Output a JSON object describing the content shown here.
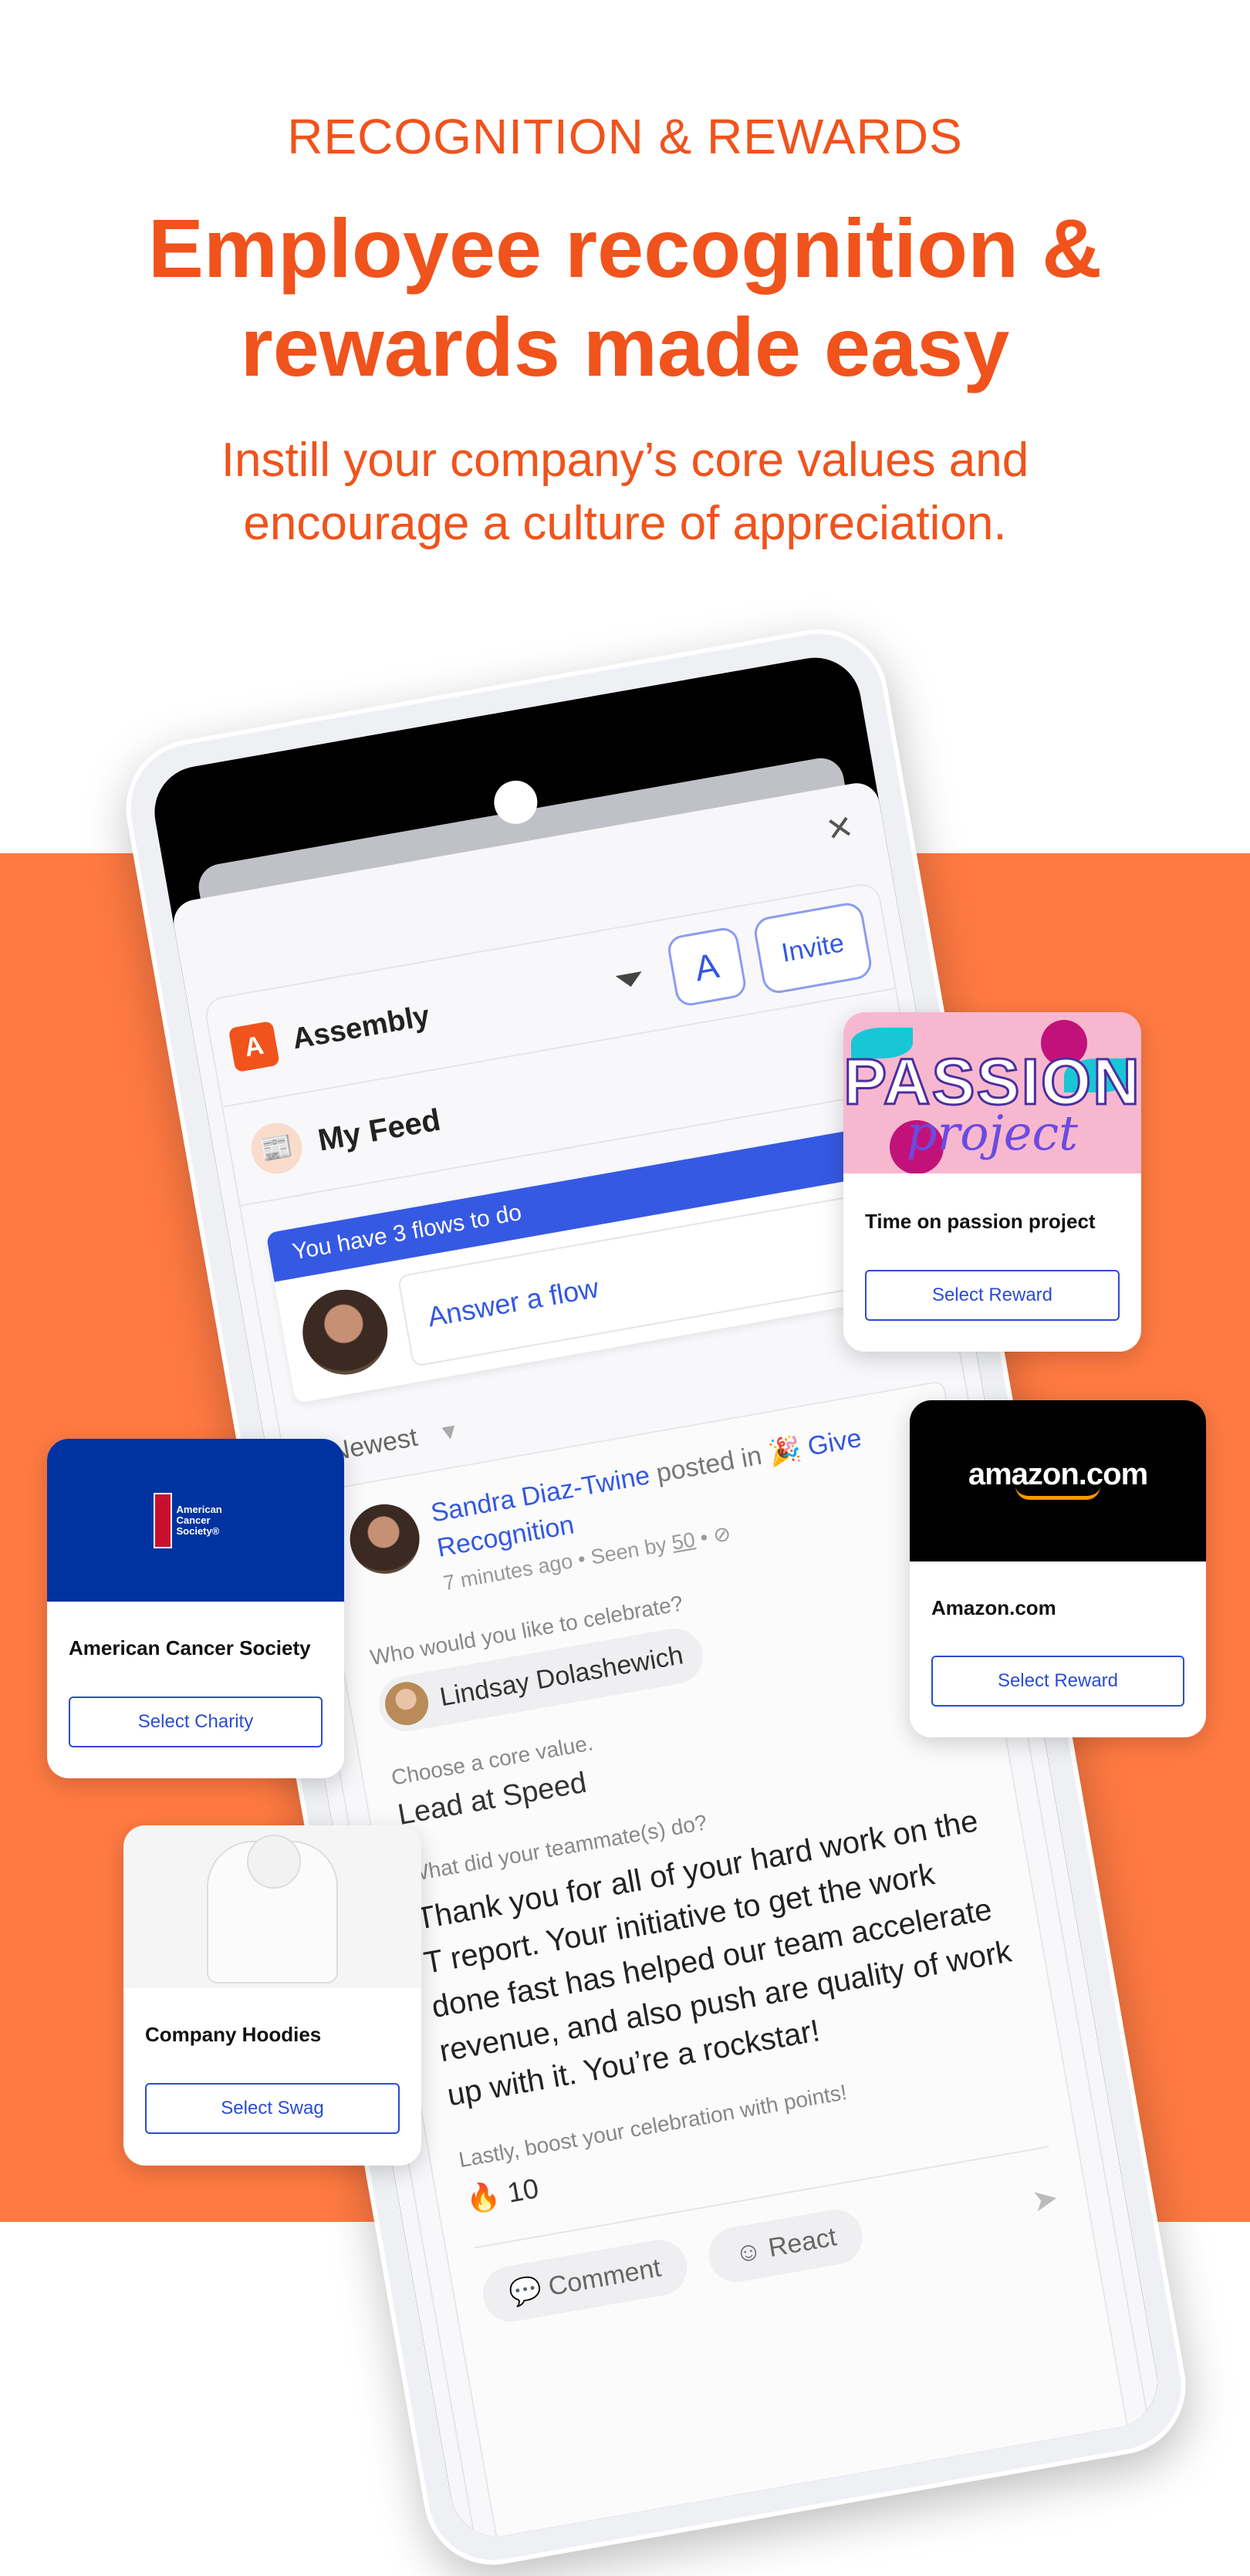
{
  "hero": {
    "eyebrow": "RECOGNITION & REWARDS",
    "title_line1": "Employee recognition &",
    "title_line2": "rewards made easy",
    "subtitle_line1": "Instill your company’s core values and",
    "subtitle_line2": "encourage a culture of appreciation."
  },
  "colors": {
    "brand_orange": "#F0531C",
    "band_orange": "#FF7A42",
    "accent_blue": "#3659E3",
    "button_blue": "#2B4BD6"
  },
  "app": {
    "close_icon": "×",
    "brand": "Assembly",
    "logo_glyph": "A",
    "invite_label": "Invite",
    "cube_glyph": "A",
    "feed_title": "My Feed",
    "banner": "You have 3 flows to do",
    "answer_placeholder": "Answer a flow",
    "sort_label": "Newest",
    "sort_caret": "▾",
    "post": {
      "author": "Sandra Diaz-Twine",
      "posted_in": " posted in ",
      "flow_emoji": "🎉",
      "flow": " Give Recognition",
      "time": "7 minutes ago",
      "seen_prefix": " • Seen by ",
      "seen_count": "50",
      "seen_suffix": " • ",
      "q1": "Who would you like to celebrate?",
      "celebrated": "Lindsay Dolashewich",
      "q2": "Choose a core value.",
      "core_value": "Lead at Speed",
      "q3": "What did your teammate(s) do?",
      "body": "Thank you for all of your hard work on the T report. Your initiative to get the work done fast has helped our team accelerate revenue, and also push are quality of work up with it. You’re a rockstar!",
      "q4": "Lastly, boost your celebration with points!",
      "points_emoji": "🔥",
      "points": "10",
      "comment_label": "Comment",
      "react_label": "React"
    }
  },
  "cards": [
    {
      "title": "Time on passion project",
      "button": "Select Reward",
      "image_word": "PASSION",
      "image_script": "project"
    },
    {
      "title": "American Cancer Society",
      "button": "Select Charity",
      "logo_text": "American Cancer Society®"
    },
    {
      "title": "Amazon.com",
      "button": "Select Reward",
      "logo_text": "amazon.com"
    },
    {
      "title": "Company Hoodies",
      "button": "Select Swag"
    }
  ]
}
